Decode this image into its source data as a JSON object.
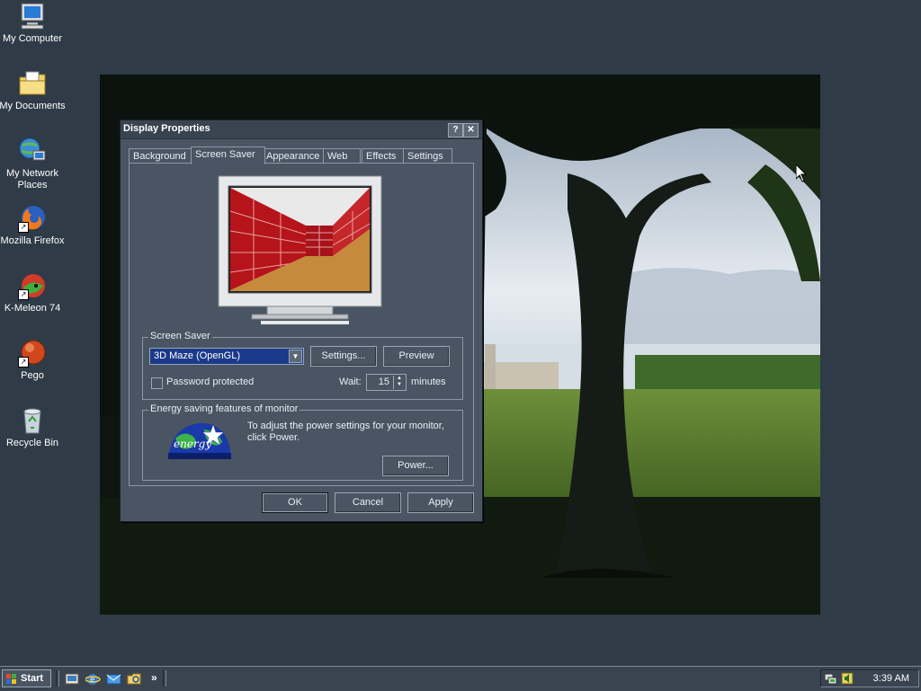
{
  "desktop": {
    "icons": [
      {
        "label": "My Computer",
        "icon": "computer-icon"
      },
      {
        "label": "My Documents",
        "icon": "folder-icon"
      },
      {
        "label": "My Network Places",
        "icon": "network-icon"
      },
      {
        "label": "Mozilla Firefox",
        "icon": "firefox-icon"
      },
      {
        "label": "K-Meleon 74",
        "icon": "kmeleon-icon"
      },
      {
        "label": "Pego",
        "icon": "pego-icon"
      },
      {
        "label": "Recycle Bin",
        "icon": "recycle-bin-icon"
      }
    ]
  },
  "dialog": {
    "title": "Display Properties",
    "help_glyph": "?",
    "close_glyph": "✕",
    "tabs": [
      "Background",
      "Screen Saver",
      "Appearance",
      "Web",
      "Effects",
      "Settings"
    ],
    "active_tab": "Screen Saver",
    "screen_saver": {
      "group_label": "Screen Saver",
      "selected": "3D Maze (OpenGL)",
      "settings_label": "Settings...",
      "preview_label": "Preview",
      "password_label": "Password protected",
      "password_checked": false,
      "wait_label": "Wait:",
      "wait_value": "15",
      "minutes_label": "minutes"
    },
    "energy": {
      "group_label": "Energy saving features of monitor",
      "description": "To adjust the power settings for your monitor, click Power.",
      "power_label": "Power...",
      "logo_text": "energy"
    },
    "buttons": {
      "ok": "OK",
      "cancel": "Cancel",
      "apply": "Apply"
    }
  },
  "taskbar": {
    "start_label": "Start",
    "quicklaunch": [
      "show-desktop-icon",
      "ie-icon",
      "outlook-icon",
      "explorer-icon"
    ],
    "chevron": "»",
    "clock": "3:39 AM"
  },
  "colors": {
    "desktop_bg": "#2f3b47",
    "dialog_bg": "#4a5563",
    "selection": "#1c3a8c"
  }
}
